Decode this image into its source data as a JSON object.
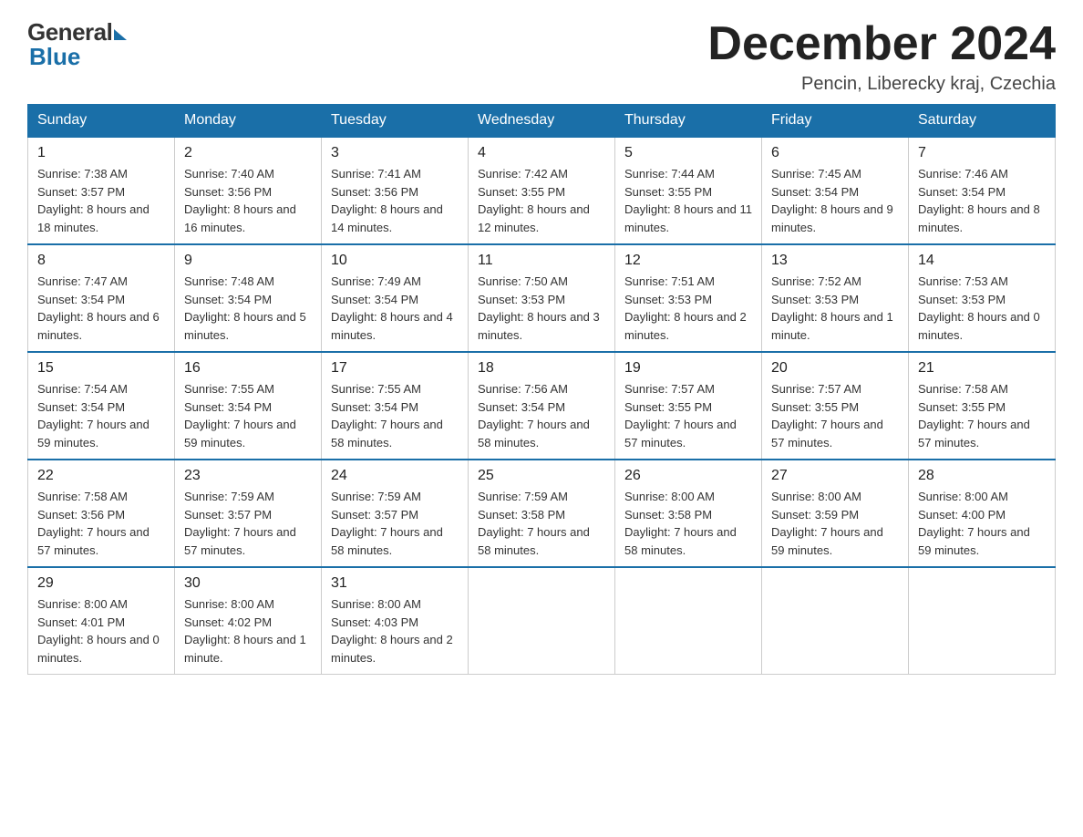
{
  "logo": {
    "general": "General",
    "blue": "Blue"
  },
  "title": "December 2024",
  "location": "Pencin, Liberecky kraj, Czechia",
  "days_of_week": [
    "Sunday",
    "Monday",
    "Tuesday",
    "Wednesday",
    "Thursday",
    "Friday",
    "Saturday"
  ],
  "weeks": [
    [
      {
        "day": "1",
        "sunrise": "7:38 AM",
        "sunset": "3:57 PM",
        "daylight": "8 hours and 18 minutes."
      },
      {
        "day": "2",
        "sunrise": "7:40 AM",
        "sunset": "3:56 PM",
        "daylight": "8 hours and 16 minutes."
      },
      {
        "day": "3",
        "sunrise": "7:41 AM",
        "sunset": "3:56 PM",
        "daylight": "8 hours and 14 minutes."
      },
      {
        "day": "4",
        "sunrise": "7:42 AM",
        "sunset": "3:55 PM",
        "daylight": "8 hours and 12 minutes."
      },
      {
        "day": "5",
        "sunrise": "7:44 AM",
        "sunset": "3:55 PM",
        "daylight": "8 hours and 11 minutes."
      },
      {
        "day": "6",
        "sunrise": "7:45 AM",
        "sunset": "3:54 PM",
        "daylight": "8 hours and 9 minutes."
      },
      {
        "day": "7",
        "sunrise": "7:46 AM",
        "sunset": "3:54 PM",
        "daylight": "8 hours and 8 minutes."
      }
    ],
    [
      {
        "day": "8",
        "sunrise": "7:47 AM",
        "sunset": "3:54 PM",
        "daylight": "8 hours and 6 minutes."
      },
      {
        "day": "9",
        "sunrise": "7:48 AM",
        "sunset": "3:54 PM",
        "daylight": "8 hours and 5 minutes."
      },
      {
        "day": "10",
        "sunrise": "7:49 AM",
        "sunset": "3:54 PM",
        "daylight": "8 hours and 4 minutes."
      },
      {
        "day": "11",
        "sunrise": "7:50 AM",
        "sunset": "3:53 PM",
        "daylight": "8 hours and 3 minutes."
      },
      {
        "day": "12",
        "sunrise": "7:51 AM",
        "sunset": "3:53 PM",
        "daylight": "8 hours and 2 minutes."
      },
      {
        "day": "13",
        "sunrise": "7:52 AM",
        "sunset": "3:53 PM",
        "daylight": "8 hours and 1 minute."
      },
      {
        "day": "14",
        "sunrise": "7:53 AM",
        "sunset": "3:53 PM",
        "daylight": "8 hours and 0 minutes."
      }
    ],
    [
      {
        "day": "15",
        "sunrise": "7:54 AM",
        "sunset": "3:54 PM",
        "daylight": "7 hours and 59 minutes."
      },
      {
        "day": "16",
        "sunrise": "7:55 AM",
        "sunset": "3:54 PM",
        "daylight": "7 hours and 59 minutes."
      },
      {
        "day": "17",
        "sunrise": "7:55 AM",
        "sunset": "3:54 PM",
        "daylight": "7 hours and 58 minutes."
      },
      {
        "day": "18",
        "sunrise": "7:56 AM",
        "sunset": "3:54 PM",
        "daylight": "7 hours and 58 minutes."
      },
      {
        "day": "19",
        "sunrise": "7:57 AM",
        "sunset": "3:55 PM",
        "daylight": "7 hours and 57 minutes."
      },
      {
        "day": "20",
        "sunrise": "7:57 AM",
        "sunset": "3:55 PM",
        "daylight": "7 hours and 57 minutes."
      },
      {
        "day": "21",
        "sunrise": "7:58 AM",
        "sunset": "3:55 PM",
        "daylight": "7 hours and 57 minutes."
      }
    ],
    [
      {
        "day": "22",
        "sunrise": "7:58 AM",
        "sunset": "3:56 PM",
        "daylight": "7 hours and 57 minutes."
      },
      {
        "day": "23",
        "sunrise": "7:59 AM",
        "sunset": "3:57 PM",
        "daylight": "7 hours and 57 minutes."
      },
      {
        "day": "24",
        "sunrise": "7:59 AM",
        "sunset": "3:57 PM",
        "daylight": "7 hours and 58 minutes."
      },
      {
        "day": "25",
        "sunrise": "7:59 AM",
        "sunset": "3:58 PM",
        "daylight": "7 hours and 58 minutes."
      },
      {
        "day": "26",
        "sunrise": "8:00 AM",
        "sunset": "3:58 PM",
        "daylight": "7 hours and 58 minutes."
      },
      {
        "day": "27",
        "sunrise": "8:00 AM",
        "sunset": "3:59 PM",
        "daylight": "7 hours and 59 minutes."
      },
      {
        "day": "28",
        "sunrise": "8:00 AM",
        "sunset": "4:00 PM",
        "daylight": "7 hours and 59 minutes."
      }
    ],
    [
      {
        "day": "29",
        "sunrise": "8:00 AM",
        "sunset": "4:01 PM",
        "daylight": "8 hours and 0 minutes."
      },
      {
        "day": "30",
        "sunrise": "8:00 AM",
        "sunset": "4:02 PM",
        "daylight": "8 hours and 1 minute."
      },
      {
        "day": "31",
        "sunrise": "8:00 AM",
        "sunset": "4:03 PM",
        "daylight": "8 hours and 2 minutes."
      },
      null,
      null,
      null,
      null
    ]
  ]
}
